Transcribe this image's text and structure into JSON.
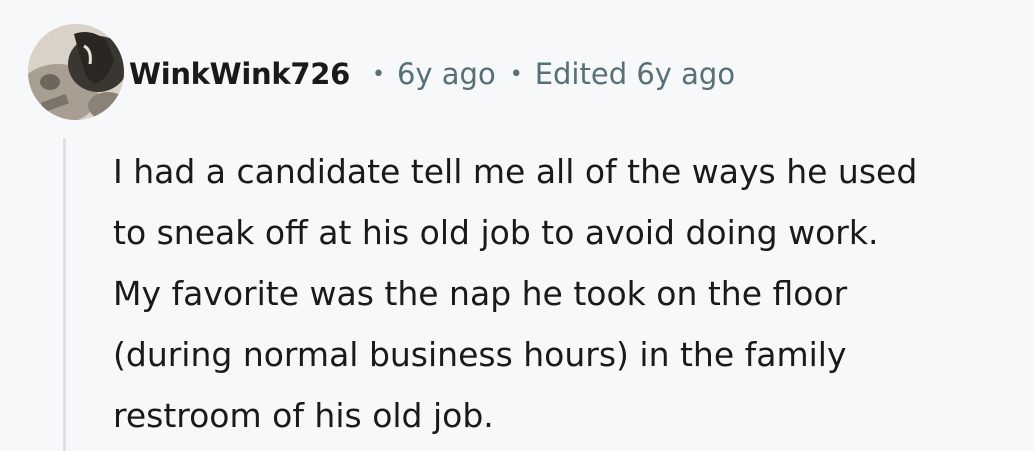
{
  "comment": {
    "username": "WinkWink726",
    "separator": "•",
    "timestamp": "6y ago",
    "edited": "Edited 6y ago",
    "body_lines": [
      "I had a candidate tell me all of the ways he used",
      "to sneak off at his old job to avoid doing work.",
      "My favorite was the nap he took on the floor",
      "(during normal business hours) in the family",
      "restroom of his old job."
    ]
  },
  "avatar": {
    "icon": "user-avatar-photo"
  },
  "colors": {
    "background": "#f7f8fa",
    "text": "#1a1a1b",
    "meta": "#576f76",
    "thread_line": "#dde1e6"
  }
}
